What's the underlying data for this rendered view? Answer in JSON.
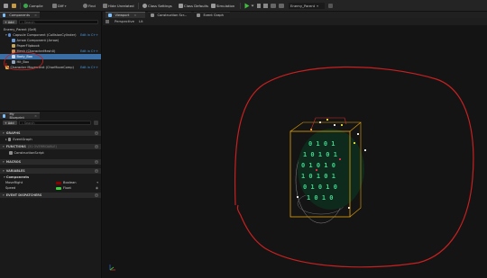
{
  "toolbar": {
    "compile": "Compile",
    "diff": "Diff",
    "find": "Find",
    "hide_unrelated": "Hide Unrelated",
    "class_settings": "Class Settings",
    "class_defaults": "Class Defaults",
    "simulation": "Simulation",
    "debug_object": "Enemy_Parent"
  },
  "components": {
    "tab_label": "Components",
    "add_label": "+ Add",
    "search_placeholder": "Search",
    "items": [
      {
        "label": "Enemy_Parent (Self)",
        "edit": ""
      },
      {
        "label": "Capsule Component (CollisionCylinder)",
        "edit": "Edit in C++"
      },
      {
        "label": "Arrow Component (Arrow)",
        "edit": ""
      },
      {
        "label": "PaperFlipbook",
        "edit": ""
      },
      {
        "label": "Mesh (CharacterMesh0)",
        "edit": "Edit in C++"
      },
      {
        "label": "Body_Box",
        "edit": ""
      },
      {
        "label": "Hit_Box",
        "edit": ""
      },
      {
        "label": "Character Movement (CharMoveComp)",
        "edit": "Edit in C++"
      }
    ]
  },
  "my_blueprint": {
    "tab_label": "My Blueprint",
    "add_label": "+ Add",
    "search_placeholder": "Search",
    "sections": {
      "graphs": "GRAPHS",
      "event_graph": "EventGraph",
      "functions": "FUNCTIONS",
      "functions_note": "(31 OVERRIDABLE)",
      "construction_script": "ConstructionScript",
      "macros": "MACROS",
      "variables": "VARIABLES",
      "components": "Components",
      "event_dispatchers": "EVENT DISPATCHERS"
    },
    "variables": [
      {
        "name": "MoveRight",
        "type": "Boolean",
        "color": "#8c0000"
      },
      {
        "name": "Speed",
        "type": "Float",
        "color": "#3fcf3f"
      }
    ]
  },
  "tabs": {
    "viewport": "Viewport",
    "construction_script": "Construction Scr...",
    "event_graph": "Event Graph"
  },
  "viewport": {
    "view_mode": "Perspective",
    "lit_mode": "Lit"
  },
  "colors": {
    "accent_blue": "#3b6ea5",
    "annotation_red": "#c82020",
    "selection_orange": "#e8a30b",
    "sprite_green": "#29c27a"
  }
}
